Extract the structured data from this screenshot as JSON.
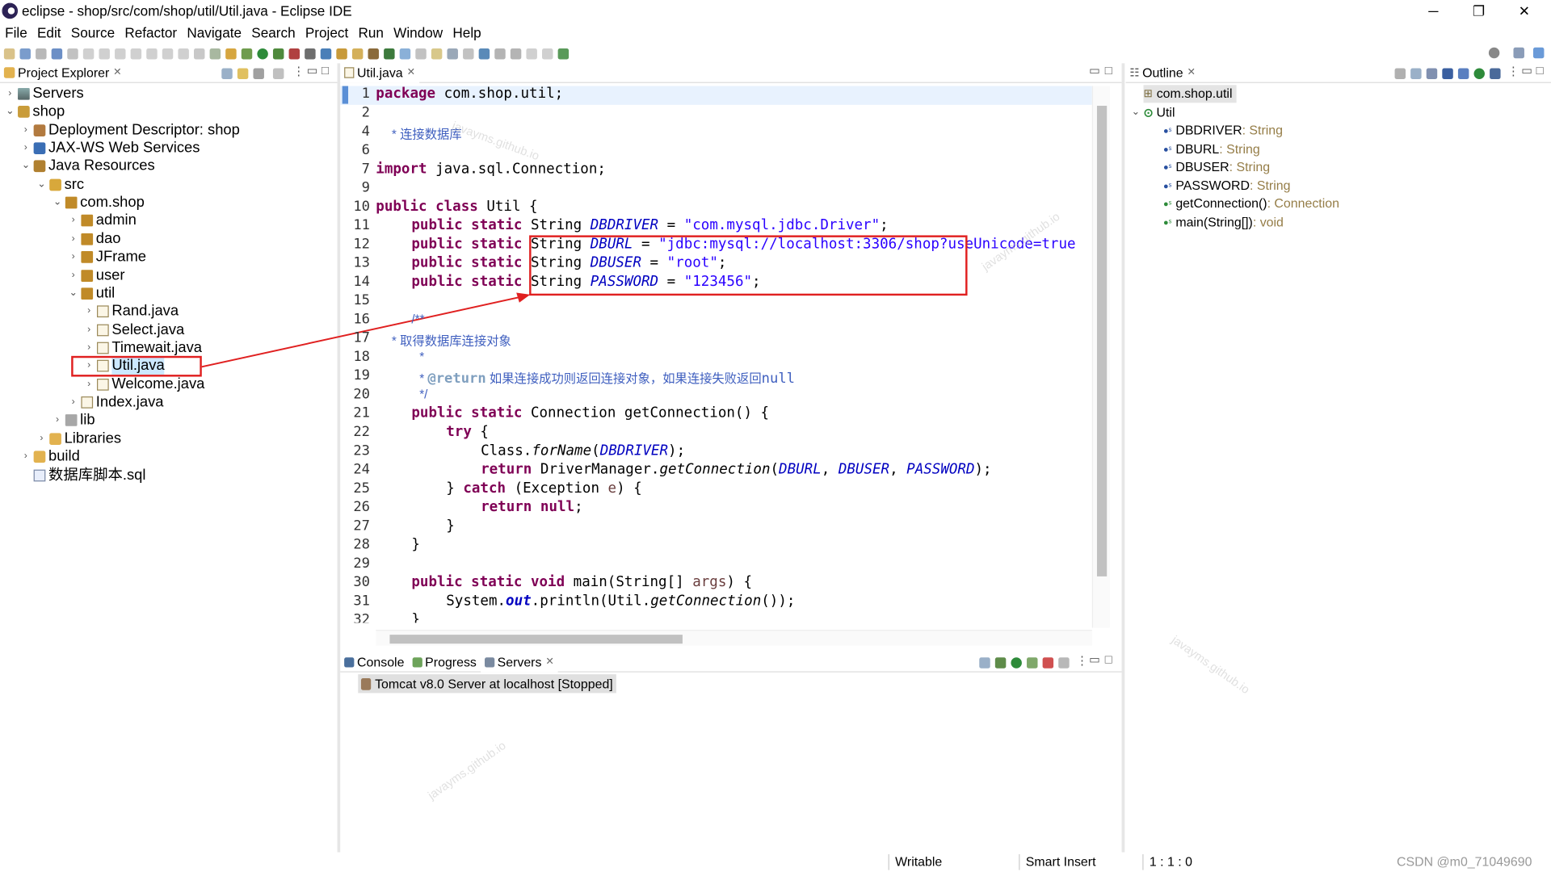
{
  "window": {
    "title": "eclipse - shop/src/com/shop/util/Util.java - Eclipse IDE",
    "minimize_glyph": "─",
    "restore_glyph": "❐",
    "close_glyph": "✕"
  },
  "menu": [
    "File",
    "Edit",
    "Source",
    "Refactor",
    "Navigate",
    "Search",
    "Project",
    "Run",
    "Window",
    "Help"
  ],
  "project_explorer": {
    "tab_label": "Project Explorer",
    "tree": [
      {
        "label": "Servers",
        "icon": "server-icon"
      },
      {
        "label": "shop",
        "icon": "project-icon"
      },
      {
        "label": "Deployment Descriptor: shop",
        "icon": "deployment-descriptor-icon"
      },
      {
        "label": "JAX-WS Web Services",
        "icon": "web-services-icon"
      },
      {
        "label": "Java Resources",
        "icon": "java-resources-icon"
      },
      {
        "label": "src",
        "icon": "source-folder-icon"
      },
      {
        "label": "com.shop",
        "icon": "package-icon"
      },
      {
        "label": "admin",
        "icon": "package-icon"
      },
      {
        "label": "dao",
        "icon": "package-icon"
      },
      {
        "label": "JFrame",
        "icon": "package-icon"
      },
      {
        "label": "user",
        "icon": "package-icon"
      },
      {
        "label": "util",
        "icon": "package-icon"
      },
      {
        "label": "Rand.java",
        "icon": "java-file-icon"
      },
      {
        "label": "Select.java",
        "icon": "java-file-icon"
      },
      {
        "label": "Timewait.java",
        "icon": "java-file-icon"
      },
      {
        "label": "Util.java",
        "icon": "java-file-icon"
      },
      {
        "label": "Welcome.java",
        "icon": "java-file-icon"
      },
      {
        "label": "Index.java",
        "icon": "java-file-icon"
      },
      {
        "label": "lib",
        "icon": "library-icon"
      },
      {
        "label": "Libraries",
        "icon": "folder-icon"
      },
      {
        "label": "build",
        "icon": "folder-icon"
      },
      {
        "label": "数据库脚本.sql",
        "icon": "sql-file-icon"
      }
    ]
  },
  "editor": {
    "tab_label": "Util.java",
    "line_numbers": [
      "1",
      "2",
      "4",
      "6",
      "7",
      "9",
      "10",
      "11",
      "12",
      "13",
      "14",
      "15",
      "16",
      "17",
      "18",
      "19",
      "20",
      "21",
      "22",
      "23",
      "24",
      "25",
      "26",
      "27",
      "28",
      "29",
      "30",
      "31",
      "32"
    ],
    "code": {
      "pkg_kw": "package",
      "pkg_name": " com.shop.util;",
      "javadoc1": "* 连接数据库",
      "import_kw": "import",
      "import_name": " java.sql.Connection;",
      "l10_a": "public class",
      "l10_b": " Util {",
      "ps": "public static",
      "string_t": " String ",
      "f_driver": "DBDRIVER",
      "f_url": "DBURL",
      "f_user": "DBUSER",
      "f_pass": "PASSWORD",
      "eq": " = ",
      "v_driver": "\"com.mysql.jdbc.Driver\"",
      "v_url": "\"jdbc:mysql://localhost:3306/shop?useUnicode=true",
      "v_user": "\"root\"",
      "v_pass": "\"123456\"",
      "semi": ";",
      "l16": "/**",
      "l17": "* 取得数据库连接对象",
      "l18": "*",
      "l19_a": "* ",
      "l19_tag": "@return",
      "l19_b": " 如果连接成功则返回连接对象，如果连接失败返回",
      "l19_null": "null",
      "l20": "*/",
      "l21_b": " Connection getConnection() {",
      "l22": "try",
      "l22_b": " {",
      "l23_a": "Class.",
      "l23_m": "forName",
      "l23_b": "(",
      "l23_c": ");",
      "l24_kw": "return",
      "l24_a": " DriverManager.",
      "l24_m": "getConnection",
      "l24_b": "(",
      "comma": ", ",
      "l24_c": ");",
      "l25_a": "} ",
      "l25_kw": "catch",
      "l25_b": " (Exception ",
      "l25_e": "e",
      "l25_c": ") {",
      "l26_kw": "return",
      "l26_null": " null",
      "l27": "}",
      "l28": "}",
      "l30_a": "public static void",
      "l30_b": " main(String[] ",
      "l30_args": "args",
      "l30_c": ") {",
      "l31_a": "System.",
      "l31_out": "out",
      "l31_b": ".println(Util.",
      "l31_m": "getConnection",
      "l31_c": "());",
      "l32": "}"
    }
  },
  "bottom_panel": {
    "tabs": [
      "Console",
      "Progress",
      "Servers"
    ],
    "server_entry": "Tomcat v8.0 Server at localhost  [Stopped]"
  },
  "outline": {
    "tab_label": "Outline",
    "items": [
      {
        "name": "com.shop.util",
        "type": ""
      },
      {
        "name": "Util",
        "type": ""
      },
      {
        "name": "DBDRIVER",
        "type": " : String"
      },
      {
        "name": "DBURL",
        "type": " : String"
      },
      {
        "name": "DBUSER",
        "type": " : String"
      },
      {
        "name": "PASSWORD",
        "type": " : String"
      },
      {
        "name": "getConnection()",
        "type": " : Connection"
      },
      {
        "name": "main(String[])",
        "type": " : void"
      }
    ]
  },
  "status": {
    "writable": "Writable",
    "insert_mode": "Smart Insert",
    "position": "1 : 1 : 0"
  },
  "watermark_text": "javayms.github.io",
  "csdn_watermark": "CSDN @m0_71049690",
  "colors": {
    "keyword": "#7f0055",
    "string": "#2a00ff",
    "field": "#0000c0",
    "javadoc": "#3f5fbf",
    "annotation_red": "#e02020",
    "selection": "#cce8ff"
  }
}
